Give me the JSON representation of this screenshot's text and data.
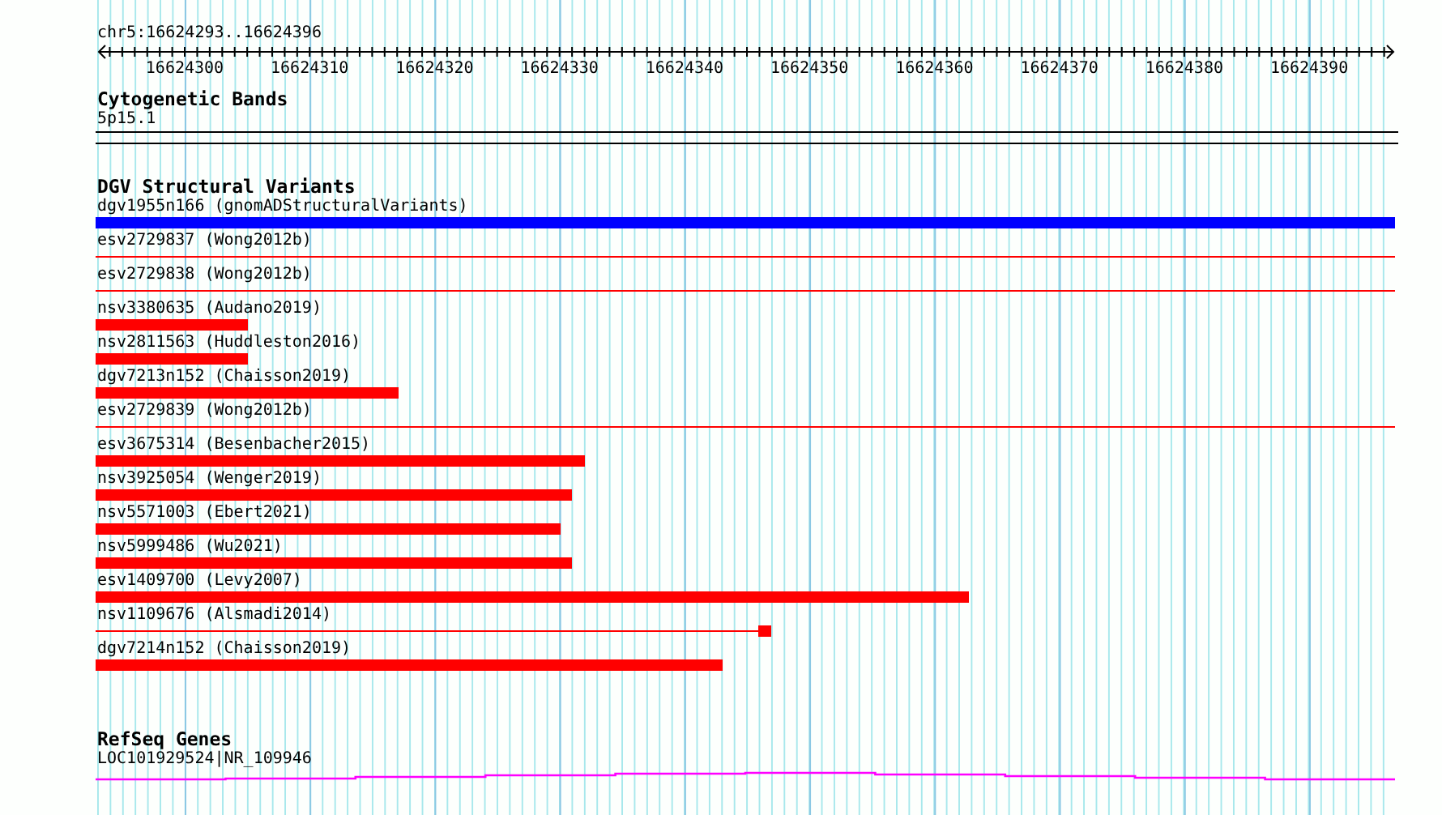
{
  "ruler": {
    "location": "chr5:16624293..16624396",
    "tick_labels": [
      "16624300",
      "16624310",
      "16624320",
      "16624330",
      "16624340",
      "16624350",
      "16624360",
      "16624370",
      "16624380",
      "16624390"
    ]
  },
  "tracks": [
    {
      "kind": "cytoband",
      "title": "Cytogenetic Bands",
      "features": [
        {
          "label": "5p15.1"
        }
      ]
    },
    {
      "kind": "variants",
      "title": "DGV Structural Variants",
      "features": [
        {
          "label": "dgv1955n166 (gnomADStructuralVariants)",
          "kind": "bar",
          "level": 1,
          "color": "#0000ff"
        },
        {
          "label": "esv2729837 (Wong2012b)",
          "kind": "line",
          "level": 1,
          "color": "#ff0000"
        },
        {
          "label": "esv2729838 (Wong2012b)",
          "kind": "line",
          "level": 1,
          "color": "#ff0000"
        },
        {
          "label": "nsv3380635 (Audano2019)",
          "kind": "bar",
          "level": 0.117,
          "color": "#ff0000"
        },
        {
          "label": "nsv2811563 (Huddleston2016)",
          "kind": "bar",
          "level": 0.117,
          "color": "#ff0000"
        },
        {
          "label": "dgv7213n152 (Chaisson2019)",
          "kind": "bar",
          "level": 0.233,
          "color": "#ff0000"
        },
        {
          "label": "esv2729839 (Wong2012b)",
          "kind": "line",
          "level": 1,
          "color": "#ff0000"
        },
        {
          "label": "esv3675314 (Besenbacher2015)",
          "kind": "bar",
          "level": 0.377,
          "color": "#ff0000"
        },
        {
          "label": "nsv3925054 (Wenger2019)",
          "kind": "bar",
          "level": 0.367,
          "color": "#ff0000"
        },
        {
          "label": "nsv5571003 (Ebert2021)",
          "kind": "bar",
          "level": 0.358,
          "color": "#ff0000"
        },
        {
          "label": "nsv5999486 (Wu2021)",
          "kind": "bar",
          "level": 0.367,
          "color": "#ff0000"
        },
        {
          "label": "esv1409700 (Levy2007)",
          "kind": "bar",
          "level": 0.672,
          "color": "#ff0000"
        },
        {
          "label": "nsv1109676 (Alsmadi2014)",
          "kind": "line-end-box",
          "level": 0.52,
          "color": "#ff0000"
        },
        {
          "label": "dgv7214n152 (Chaisson2019)",
          "kind": "bar",
          "level": 0.483,
          "color": "#ff0000"
        }
      ]
    },
    {
      "kind": "gene",
      "title": "RefSeq Genes",
      "features": [
        {
          "label": "LOC101929524|NR_109946",
          "color": "#ff00ff"
        }
      ]
    }
  ]
}
